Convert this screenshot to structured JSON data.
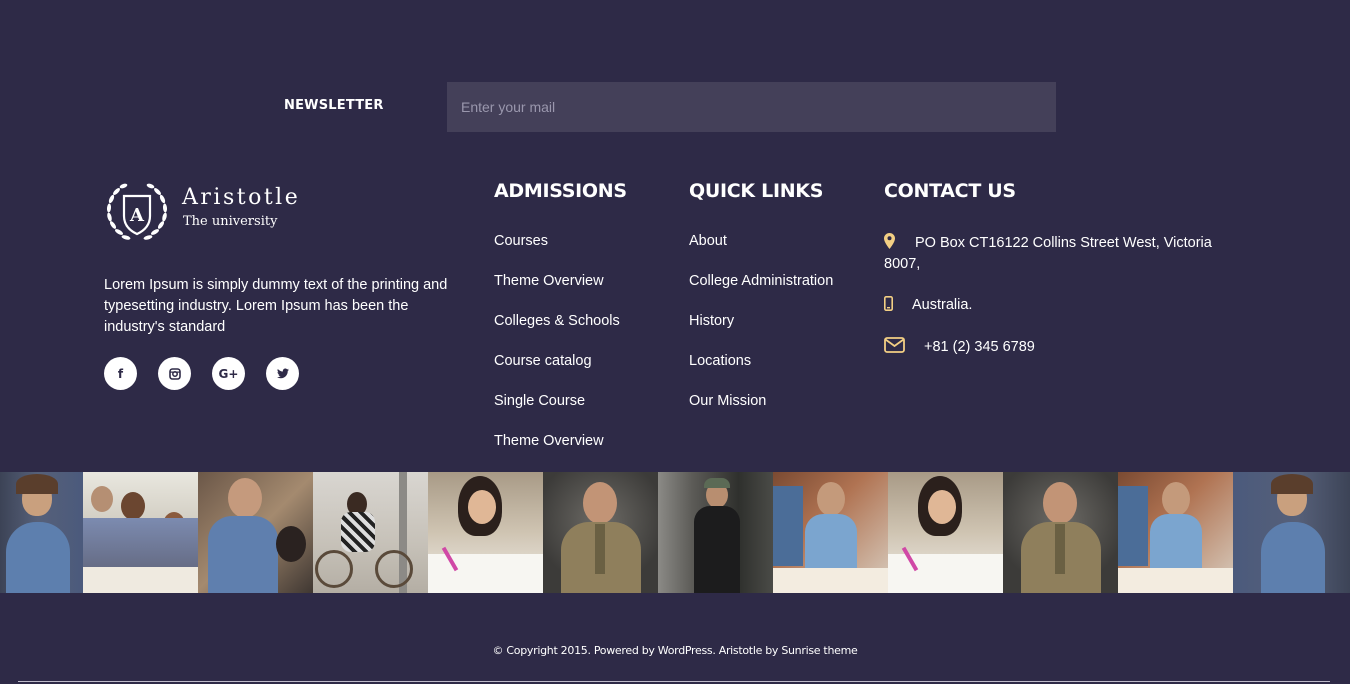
{
  "newsletter": {
    "label": "NEWSLETTER",
    "placeholder": "Enter your mail"
  },
  "brand": {
    "name": "Aristotle",
    "tagline": "The university",
    "emblem_letter": "A",
    "description": "Lorem Ipsum is simply dummy text of the printing and typesetting industry. Lorem Ipsum has been the industry's standard"
  },
  "social": [
    {
      "icon": "facebook-icon",
      "glyph": "f"
    },
    {
      "icon": "instagram-icon",
      "glyph": ""
    },
    {
      "icon": "google-plus-icon",
      "glyph": "G+"
    },
    {
      "icon": "twitter-icon",
      "glyph": ""
    }
  ],
  "admissions": {
    "title": "ADMISSIONS",
    "links": [
      "Courses",
      "Theme Overview",
      "Colleges & Schools",
      "Course catalog",
      "Single Course",
      "Theme Overview"
    ]
  },
  "quick_links": {
    "title": "QUICK LINKS",
    "links": [
      "About",
      "College Administration",
      "History",
      "Locations",
      "Our Mission"
    ]
  },
  "contact": {
    "title": "CONTACT US",
    "address": "PO Box CT16122 Collins Street West, Victoria 8007,",
    "country": "Australia.",
    "phone": "+81 (2) 345 6789",
    "icon_color": "#f3cf84"
  },
  "gallery": [
    "woman-denim-photo",
    "team-meeting-photo",
    "man-laptop-photo",
    "cyclist-photo",
    "student-writing-photo",
    "professor-photo",
    "man-backpack-photo",
    "man-computer-photo",
    "student-writing-photo",
    "professor-photo",
    "man-computer-photo",
    "woman-denim-photo"
  ],
  "footer": {
    "copyright": "© Copyright 2015. Powered by WordPress. Aristotle by Sunrise theme"
  },
  "colors": {
    "background": "#2e2a47",
    "input_background": "#444059",
    "accent": "#f3cf84"
  }
}
